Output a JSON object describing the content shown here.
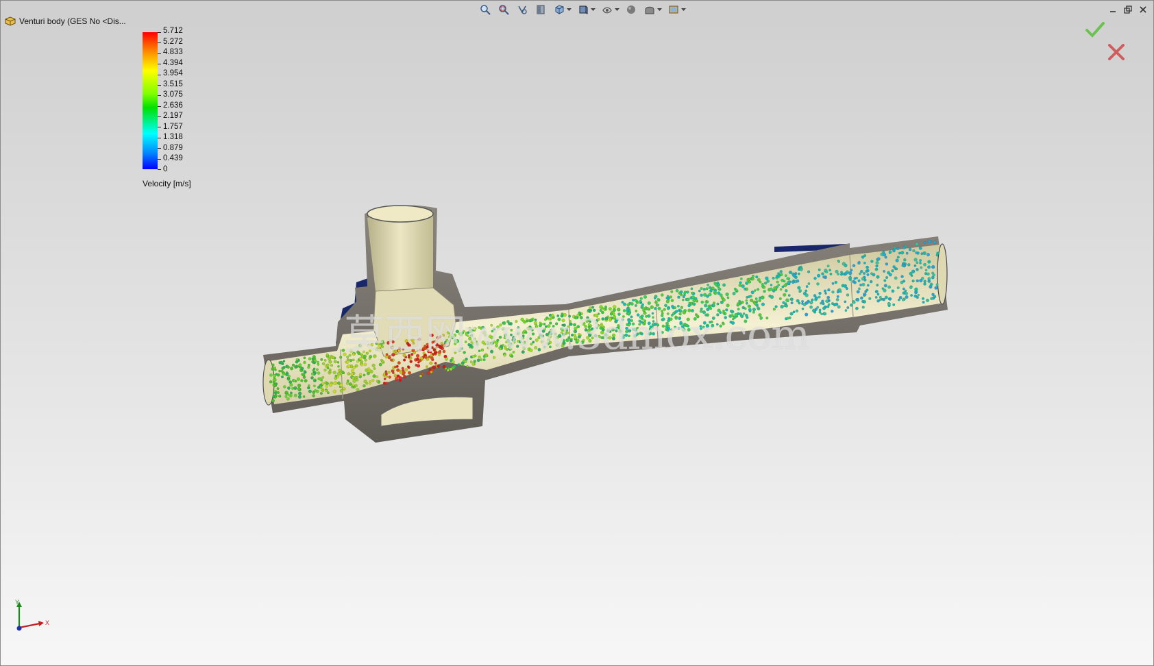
{
  "tree": {
    "label": "Venturi body  (GES No <Dis..."
  },
  "toolbar": {
    "buttons": [
      "zoom-to-fit-icon",
      "zoom-to-area-icon",
      "previous-view-icon",
      "section-view-icon",
      "view-orientation-icon",
      "display-style-icon",
      "hide-show-items-icon",
      "edit-appearance-icon",
      "apply-scene-icon",
      "view-settings-icon"
    ]
  },
  "legend": {
    "ticks": [
      "5.712",
      "5.272",
      "4.833",
      "4.394",
      "3.954",
      "3.515",
      "3.075",
      "2.636",
      "2.197",
      "1.757",
      "1.318",
      "0.879",
      "0.439",
      "0"
    ],
    "title": "Velocity [m/s]",
    "colors": {
      "max": "#ff0000",
      "mid": "#00e000",
      "min": "#0000ff"
    }
  },
  "watermark": {
    "text": "莫西网www.3dmox.com"
  },
  "triad": {
    "x_label": "X",
    "y_label": "Y"
  },
  "colors": {
    "body": "#efeac8",
    "wall": "#6e6a64",
    "ok": "#5bbf3a",
    "cancel": "#d04040"
  }
}
